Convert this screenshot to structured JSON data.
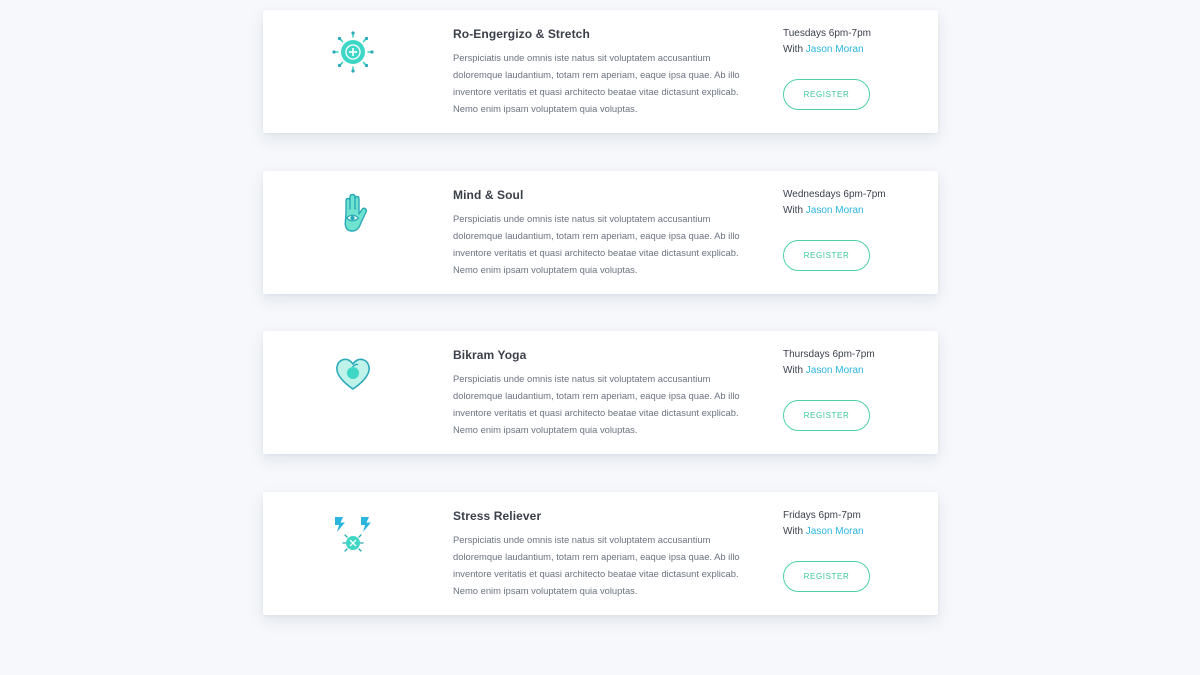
{
  "colors": {
    "page_background": "#f6f8fb",
    "card_background": "#ffffff",
    "title_text": "#3a3f4a",
    "body_text": "#6b7380",
    "instructor_link": "#2bb6e0",
    "button_accent": "#4fd1a5",
    "icon_teal": "#3ed6c4"
  },
  "classes": [
    {
      "icon": "sun-plus-icon",
      "title": "Ro-Engergizo & Stretch",
      "description": "Perspiciatis unde omnis iste natus sit voluptatem accusantium doloremque laudantium, totam rem aperiam, eaque ipsa quae. Ab illo inventore veritatis et quasi architecto beatae vitae dictasunt explicab. Nemo enim ipsam voluptatem quia voluptas.",
      "schedule": "Tuesdays 6pm-7pm",
      "with_label": "With",
      "instructor": "Jason Moran",
      "register_label": "REGISTER"
    },
    {
      "icon": "hamsa-hand-icon",
      "title": "Mind & Soul",
      "description": "Perspiciatis unde omnis iste natus sit voluptatem accusantium doloremque laudantium, totam rem aperiam, eaque ipsa quae. Ab illo inventore veritatis et quasi architecto beatae vitae dictasunt explicab. Nemo enim ipsam voluptatem quia voluptas.",
      "schedule": "Wednesdays 6pm-7pm",
      "with_label": "With",
      "instructor": "Jason Moran",
      "register_label": "REGISTER"
    },
    {
      "icon": "heart-apple-icon",
      "title": "Bikram Yoga",
      "description": "Perspiciatis unde omnis iste natus sit voluptatem accusantium doloremque laudantium, totam rem aperiam, eaque ipsa quae. Ab illo inventore veritatis et quasi architecto beatae vitae dictasunt explicab. Nemo enim ipsam voluptatem quia voluptas.",
      "schedule": "Thursdays 6pm-7pm",
      "with_label": "With",
      "instructor": "Jason Moran",
      "register_label": "REGISTER"
    },
    {
      "icon": "lightning-ball-icon",
      "title": "Stress Reliever",
      "description": "Perspiciatis unde omnis iste natus sit voluptatem accusantium doloremque laudantium, totam rem aperiam, eaque ipsa quae. Ab illo inventore veritatis et quasi architecto beatae vitae dictasunt explicab. Nemo enim ipsam voluptatem quia voluptas.",
      "schedule": "Fridays 6pm-7pm",
      "with_label": "With",
      "instructor": "Jason Moran",
      "register_label": "REGISTER"
    }
  ]
}
